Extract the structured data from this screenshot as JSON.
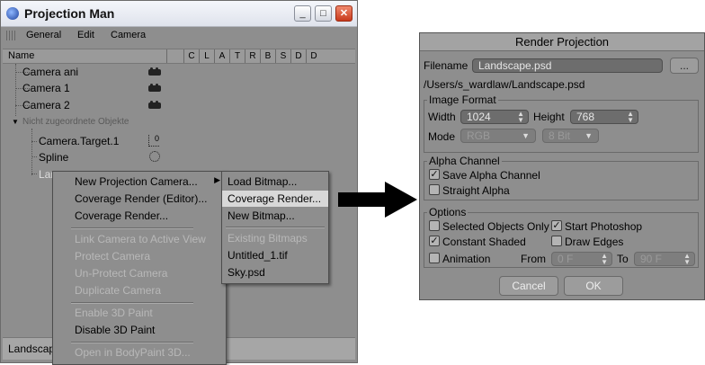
{
  "projection_man": {
    "title": "Projection Man",
    "menu": [
      "General",
      "Edit",
      "Camera"
    ],
    "header_name": "Name",
    "columns": [
      "C",
      "L",
      "A",
      "T",
      "R",
      "B",
      "S",
      "D",
      "D"
    ],
    "tree": [
      {
        "label": "Camera ani",
        "icon": "camera-icon"
      },
      {
        "label": "Camera 1",
        "icon": "camera-icon"
      },
      {
        "label": "Camera 2",
        "icon": "camera-icon"
      },
      {
        "label": "Nicht zugeordnete Objekte"
      },
      {
        "label": "Camera.Target.1",
        "icon": "null-object-icon"
      },
      {
        "label": "Spline",
        "icon": "spline-icon"
      },
      {
        "label": "Lan"
      }
    ],
    "status": "Landscap"
  },
  "context_menu": {
    "items": [
      {
        "label": "New Projection Camera...",
        "disabled": false,
        "submenu": true
      },
      {
        "label": "Coverage Render (Editor)...",
        "disabled": false
      },
      {
        "label": "Coverage Render...",
        "disabled": false
      },
      {
        "label": "Link Camera to Active View",
        "disabled": true
      },
      {
        "label": "Protect Camera",
        "disabled": true
      },
      {
        "label": "Un-Protect Camera",
        "disabled": true
      },
      {
        "label": "Duplicate Camera",
        "disabled": true
      },
      {
        "label": "Enable 3D Paint",
        "disabled": true
      },
      {
        "label": "Disable 3D Paint",
        "disabled": false
      },
      {
        "label": "Open in BodyPaint 3D...",
        "disabled": true
      }
    ]
  },
  "submenu": {
    "items": [
      {
        "label": "Load Bitmap...",
        "disabled": false
      },
      {
        "label": "Coverage Render...",
        "disabled": false,
        "highlighted": true
      },
      {
        "label": "New Bitmap...",
        "disabled": false
      },
      {
        "label": "Existing Bitmaps",
        "disabled": true
      },
      {
        "label": "Untitled_1.tif",
        "disabled": false
      },
      {
        "label": "Sky.psd",
        "disabled": false
      }
    ]
  },
  "render_projection": {
    "title": "Render Projection",
    "filename_label": "Filename",
    "filename_value": "Landscape.psd",
    "browse_label": "...",
    "path": "/Users/s_wardlaw/Landscape.psd",
    "image_format": {
      "title": "Image Format",
      "width_label": "Width",
      "width_value": "1024",
      "height_label": "Height",
      "height_value": "768",
      "mode_label": "Mode",
      "mode_value": "RGB",
      "depth_value": "8 Bit"
    },
    "alpha_channel": {
      "title": "Alpha Channel",
      "save_alpha": {
        "label": "Save Alpha Channel",
        "checked": true
      },
      "straight_alpha": {
        "label": "Straight Alpha",
        "checked": false
      }
    },
    "options": {
      "title": "Options",
      "selected_only": {
        "label": "Selected Objects Only",
        "checked": false
      },
      "start_photoshop": {
        "label": "Start Photoshop",
        "checked": true
      },
      "constant_shaded": {
        "label": "Constant Shaded",
        "checked": true
      },
      "draw_edges": {
        "label": "Draw Edges",
        "checked": false
      },
      "animation": {
        "label": "Animation",
        "checked": false
      },
      "from_label": "From",
      "from_value": "0 F",
      "to_label": "To",
      "to_value": "90 F"
    },
    "cancel_label": "Cancel",
    "ok_label": "OK"
  },
  "colors": {
    "panel": "#8e8e8e",
    "field": "#6d6d6d",
    "highlight": "#d8d8d8"
  }
}
